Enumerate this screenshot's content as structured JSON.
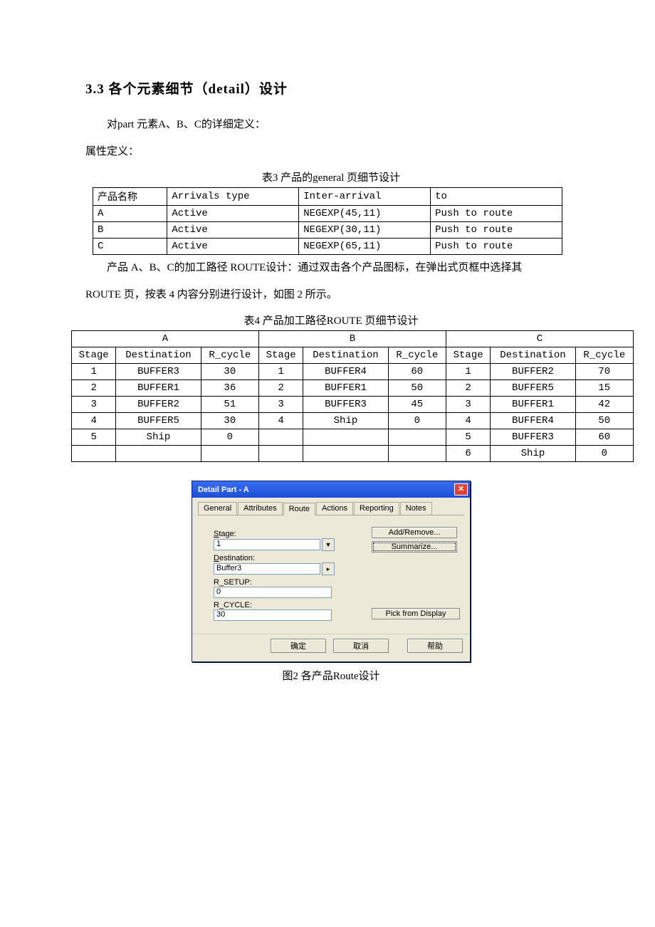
{
  "section": {
    "heading": "3.3 各个元素细节（detail）设计",
    "intro1": "对part 元素A、B、C的详细定义：",
    "intro2": "属性定义：",
    "t3_caption": "表3 产品的general 页细节设计",
    "t3_head": {
      "c0": "产品名称",
      "c1": "Arrivals type",
      "c2": "Inter-arrival",
      "c3": "to"
    },
    "t3_rows": [
      {
        "c0": "A",
        "c1": "Active",
        "c2": "NEGEXP(45,11)",
        "c3": "Push to route"
      },
      {
        "c0": "B",
        "c1": "Active",
        "c2": "NEGEXP(30,11)",
        "c3": "Push to route"
      },
      {
        "c0": "C",
        "c1": "Active",
        "c2": "NEGEXP(65,11)",
        "c3": "Push to route"
      }
    ],
    "para2a": "产品 A、B、C的加工路径 ROUTE设计：通过双击各个产品图标，在弹出式页框中选择其",
    "para2b": "ROUTE 页，按表 4 内容分别进行设计，如图 2 所示。",
    "t4_caption": "表4 产品加工路径ROUTE 页细节设计",
    "t4_group": {
      "a": "A",
      "b": "B",
      "c": "C"
    },
    "t4_sub": {
      "stage": "Stage",
      "dest": "Destination",
      "rcycle": "R_cycle"
    },
    "t4_rows": [
      {
        "a_s": "1",
        "a_d": "BUFFER3",
        "a_r": "30",
        "b_s": "1",
        "b_d": "BUFFER4",
        "b_r": "60",
        "c_s": "1",
        "c_d": "BUFFER2",
        "c_r": "70"
      },
      {
        "a_s": "2",
        "a_d": "BUFFER1",
        "a_r": "36",
        "b_s": "2",
        "b_d": "BUFFER1",
        "b_r": "50",
        "c_s": "2",
        "c_d": "BUFFER5",
        "c_r": "15"
      },
      {
        "a_s": "3",
        "a_d": "BUFFER2",
        "a_r": "51",
        "b_s": "3",
        "b_d": "BUFFER3",
        "b_r": "45",
        "c_s": "3",
        "c_d": "BUFFER1",
        "c_r": "42"
      },
      {
        "a_s": "4",
        "a_d": "BUFFER5",
        "a_r": "30",
        "b_s": "4",
        "b_d": "Ship",
        "b_r": "0",
        "c_s": "4",
        "c_d": "BUFFER4",
        "c_r": "50"
      },
      {
        "a_s": "5",
        "a_d": "Ship",
        "a_r": "0",
        "b_s": "",
        "b_d": "",
        "b_r": "",
        "c_s": "5",
        "c_d": "BUFFER3",
        "c_r": "60"
      },
      {
        "a_s": "",
        "a_d": "",
        "a_r": "",
        "b_s": "",
        "b_d": "",
        "b_r": "",
        "c_s": "6",
        "c_d": "Ship",
        "c_r": "0"
      }
    ],
    "fig_caption": "图2 各产品Route设计"
  },
  "dialog": {
    "title": "Detail Part - A",
    "tabs": {
      "general": "General",
      "attributes": "Attributes",
      "route": "Route",
      "actions": "Actions",
      "reporting": "Reporting",
      "notes": "Notes"
    },
    "labels": {
      "stage": "Stage:",
      "destination": "Destination:",
      "rsetup": "R_SETUP:",
      "rcycle": "R_CYCLE:"
    },
    "values": {
      "stage": "1",
      "destination": "Buffer3",
      "rsetup": "0",
      "rcycle": "30"
    },
    "buttons": {
      "addremove": "Add/Remove...",
      "summarize": "Summarize...",
      "pick": "Pick from Display",
      "ok": "确定",
      "cancel": "取消",
      "help": "帮助"
    }
  }
}
